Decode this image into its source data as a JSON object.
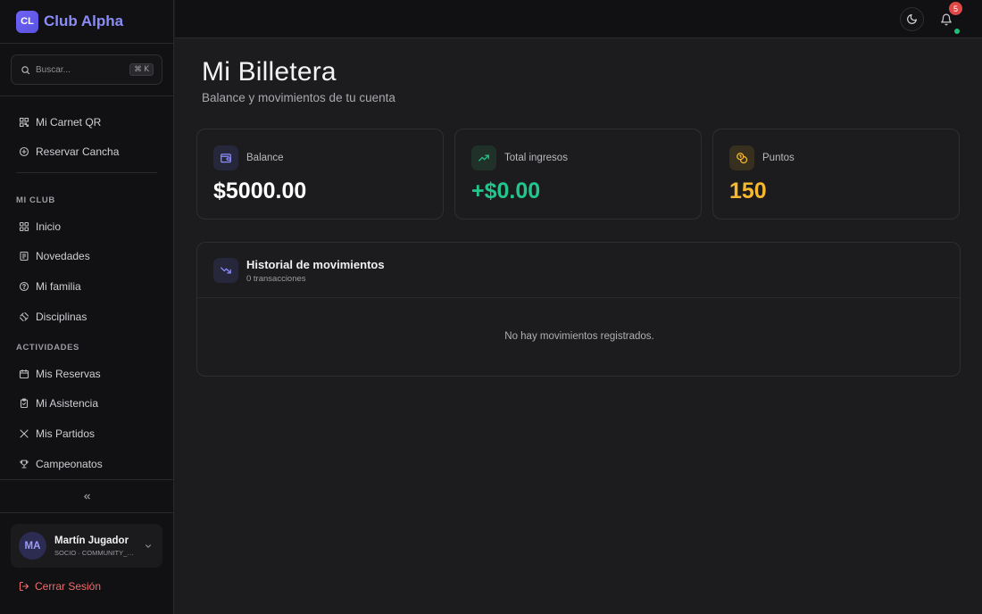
{
  "brand": {
    "logo_text": "CL",
    "name": "Club Alpha"
  },
  "search": {
    "placeholder": "Buscar...",
    "shortcut": "⌘ K"
  },
  "sidebar": {
    "top_items": [
      {
        "label": "Mi Carnet QR",
        "icon": "qr-code-icon"
      },
      {
        "label": "Reservar Cancha",
        "icon": "plus-circle-icon"
      }
    ],
    "sections": [
      {
        "title": "MI CLUB",
        "items": [
          {
            "label": "Inicio",
            "icon": "grid-icon"
          },
          {
            "label": "Novedades",
            "icon": "newspaper-icon"
          },
          {
            "label": "Mi familia",
            "icon": "family-icon"
          },
          {
            "label": "Disciplinas",
            "icon": "dumbbell-icon"
          }
        ]
      },
      {
        "title": "ACTIVIDADES",
        "items": [
          {
            "label": "Mis Reservas",
            "icon": "calendar-icon"
          },
          {
            "label": "Mi Asistencia",
            "icon": "clipboard-check-icon"
          },
          {
            "label": "Mis Partidos",
            "icon": "swords-icon"
          },
          {
            "label": "Campeonatos",
            "icon": "trophy-icon"
          }
        ]
      }
    ],
    "collapse_icon": "chevrons-left-icon"
  },
  "user": {
    "initials": "MA",
    "name": "Martín Jugador",
    "role": "SOCIO · COMMUNITY_MEMBER"
  },
  "logout": {
    "label": "Cerrar Sesión"
  },
  "header": {
    "theme_icon": "moon-icon",
    "bell_icon": "bell-icon",
    "notification_count": "5"
  },
  "page": {
    "title": "Mi Billetera",
    "subtitle": "Balance y movimientos de tu cuenta"
  },
  "cards": [
    {
      "label": "Balance",
      "value": "$5000.00",
      "icon": "wallet-icon",
      "color": "#ffffff",
      "icon_bg": "#26273a",
      "icon_color": "#8a8cf7"
    },
    {
      "label": "Total ingresos",
      "value": "+$0.00",
      "icon": "trending-up-icon",
      "color": "#22c58b",
      "icon_bg": "#1f3129",
      "icon_color": "#22c58b"
    },
    {
      "label": "Puntos",
      "value": "150",
      "icon": "coins-icon",
      "color": "#f5b82e",
      "icon_bg": "#37301e",
      "icon_color": "#f5b82e"
    }
  ],
  "history": {
    "title": "Historial de movimientos",
    "count": "0 transacciones",
    "empty": "No hay movimientos registrados.",
    "icon": "trending-down-icon"
  }
}
